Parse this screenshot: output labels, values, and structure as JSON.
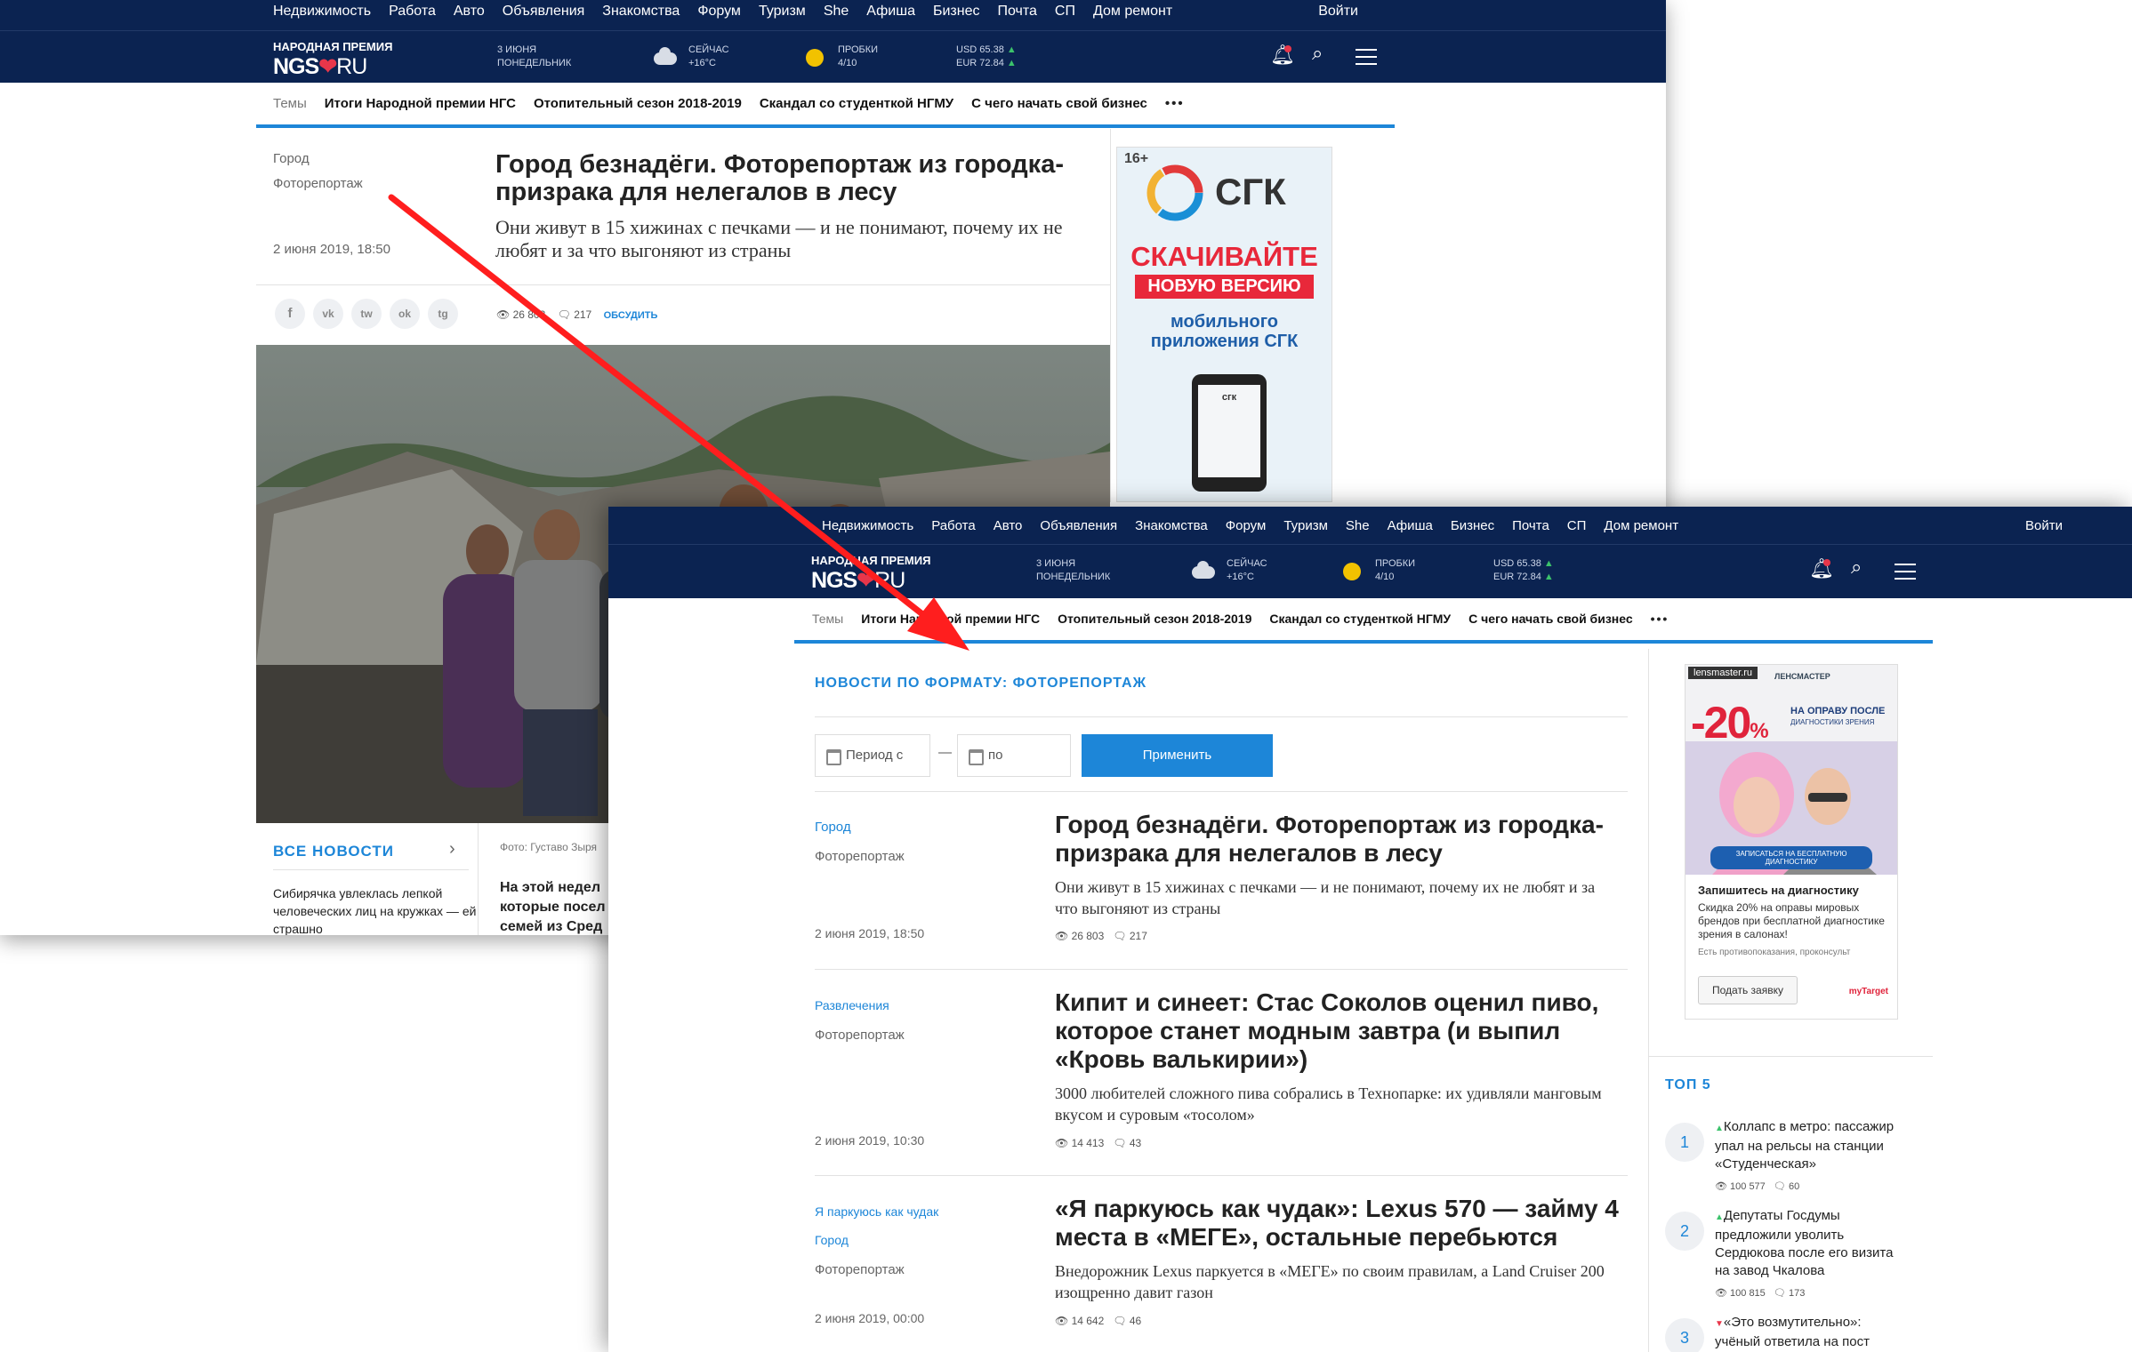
{
  "nav": {
    "items": [
      "Недвижимость",
      "Работа",
      "Авто",
      "Объявления",
      "Знакомства",
      "Форум",
      "Туризм",
      "She",
      "Афиша",
      "Бизнес",
      "Почта",
      "СП",
      "Дом ремонт"
    ],
    "login": "Войти"
  },
  "header": {
    "logo_top": "НАРОДНАЯ ПРЕМИЯ",
    "logo_ngs": "NGS",
    "logo_ru": "RU",
    "date_line1": "3 ИЮНЯ",
    "date_line2": "ПОНЕДЕЛЬНИК",
    "weather_line1": "СЕЙЧАС",
    "weather_line2": "+16°C",
    "traffic_line1": "ПРОБКИ",
    "traffic_line2": "4/10",
    "usd": "USD 65.38",
    "eur": "EUR 72.84",
    "icons": [
      "bell-icon",
      "search-icon",
      "menu-icon"
    ]
  },
  "topics": {
    "label": "Темы",
    "items": [
      "Итоги Народной премии НГС",
      "Отопительный сезон 2018-2019",
      "Скандал со студенткой НГМУ",
      "С чего начать свой бизнес"
    ],
    "more": "•••"
  },
  "article": {
    "cat1": "Город",
    "cat2": "Фоторепортаж",
    "date": "2 июня 2019, 18:50",
    "title": "Город безнадёги. Фоторепортаж из городка-призрака для нелегалов в лесу",
    "lead": "Они живут в 15 хижинах с печками — и не понимают, почему их не любят и за что выгоняют из страны",
    "share": [
      "f",
      "vk",
      "tw",
      "ok",
      "tg"
    ],
    "views": "26 803",
    "comments": "217",
    "discuss": "ОБСУДИТЬ",
    "photo_credit": "Фото: Густаво Зыря",
    "all_news": "ВСЕ НОВОСТИ",
    "side_news": "Сибирячка увлеклась лепкой человеческих лиц на кружках — ей страшно",
    "teaser": "На этой недел которые посел семей из Сред"
  },
  "ad1": {
    "age": "16+",
    "brand": "СГК",
    "line1": "СКАЧИВАЙТЕ",
    "line2": "НОВУЮ ВЕРСИЮ",
    "line3": "мобильного приложения СГК",
    "phone_logo": "сгк"
  },
  "listing": {
    "section_title": "НОВОСТИ ПО ФОРМАТУ: ФОТОРЕПОРТАЖ",
    "period_from": "Период с",
    "dash": "—",
    "period_to": "по",
    "apply": "Применить",
    "articles": [
      {
        "cats": [
          "Город",
          "Фоторепортаж"
        ],
        "date": "2 июня 2019, 18:50",
        "title": "Город безнадёги. Фоторепортаж из городка-призрака для нелегалов в лесу",
        "lead": "Они живут в 15 хижинах с печками — и не понимают, почему их не любят и за что выгоняют из страны",
        "views": "26 803",
        "comments": "217"
      },
      {
        "cats": [
          "Развлечения",
          "Фоторепортаж"
        ],
        "date": "2 июня 2019, 10:30",
        "title": "Кипит и синеет: Стас Соколов оценил пиво, которое станет модным завтра (и выпил «Кровь валькирии»)",
        "lead": "3000 любителей сложного пива собрались в Технопарке: их удивляли манговым вкусом и суровым «тосолом»",
        "views": "14 413",
        "comments": "43"
      },
      {
        "cats": [
          "Я паркуюсь как чудак",
          "Город",
          "Фоторепортаж"
        ],
        "date": "2 июня 2019, 00:00",
        "title": "«Я паркуюсь как чудак»: Lexus 570 — займу 4 места в «МЕГЕ», остальные перебьются",
        "lead": "Внедорожник Lexus паркуется в «МЕГЕ» по своим правилам, а Land Cruiser 200 изощренно давит газон",
        "views": "14 642",
        "comments": "46"
      }
    ]
  },
  "ad2": {
    "site": "lensmaster.ru",
    "brand": "ЛЕНСМАСТЕР",
    "discount": "-20",
    "pct": "%",
    "offer1": "НА ОПРАВУ ПОСЛЕ",
    "offer2": "ДИАГНОСТИКИ ЗРЕНИЯ",
    "cta_banner": "ЗАПИСАТЬСЯ НА БЕСПЛАТНУЮ ДИАГНОСТИКУ",
    "headline": "Запишитесь на диагностику",
    "text": "Скидка 20% на оправы мировых брендов при бесплатной диагностике зрения в салонах!",
    "disclaimer": "Есть противопоказания, проконсульт",
    "button": "Подать заявку",
    "corner": "myTarget"
  },
  "top5": {
    "title": "ТОП 5",
    "items": [
      {
        "num": "1",
        "text": "Коллапс в метро: пассажир упал на рельсы на станции «Студенческая»",
        "views": "100 577",
        "comments": "60",
        "trend": "up"
      },
      {
        "num": "2",
        "text": "Депутаты Госдумы предложили уволить Сердюкова после его визита на завод Чкалова",
        "views": "100 815",
        "comments": "173",
        "trend": "up"
      },
      {
        "num": "3",
        "text": "«Это возмутительно»: учёный ответила на пост Толоконской",
        "views": "",
        "comments": "",
        "trend": "down"
      }
    ]
  },
  "colors": {
    "header_bg": "#0b2351",
    "accent": "#1d86d8",
    "heart": "#e8364a",
    "arrow": "#ff1e1e"
  }
}
